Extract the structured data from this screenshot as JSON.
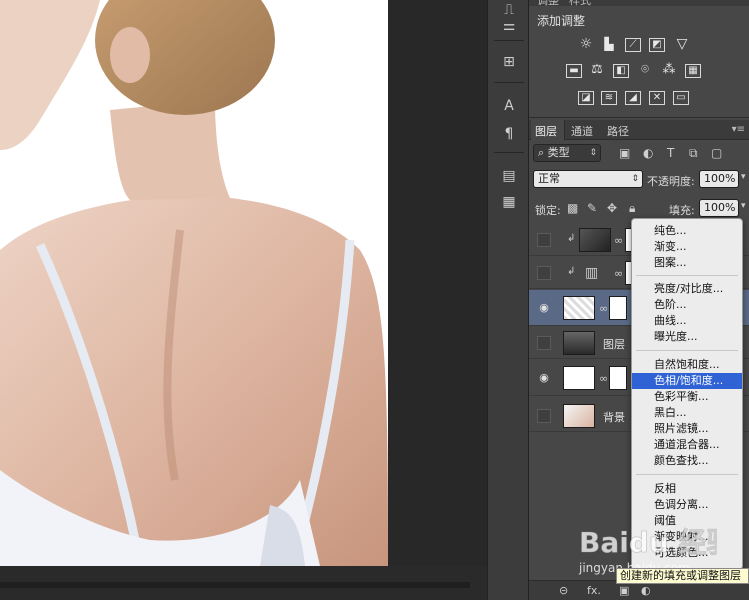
{
  "adjustments": {
    "tabs": [
      "调整",
      "样式"
    ],
    "title": "添加调整",
    "row1_icons": [
      "brightness-icon",
      "levels-icon",
      "curves-icon",
      "exposure-icon",
      "triangle-icon"
    ],
    "row2_icons": [
      "vibrance-icon",
      "balance-icon",
      "bw-icon",
      "camera-icon",
      "circles-icon",
      "grid-icon"
    ],
    "row3_icons": [
      "invert-icon",
      "posterize-icon",
      "threshold-icon",
      "selective-icon",
      "gradient-map-icon"
    ]
  },
  "layers": {
    "tabs": [
      "图层",
      "通道",
      "路径"
    ],
    "filter_kind": "类型",
    "blend_mode": "正常",
    "opacity_label": "不透明度:",
    "opacity_value": "100%",
    "lock_label": "锁定:",
    "fill_label": "填充:",
    "fill_value": "100%",
    "items": [
      {
        "name": "",
        "visible": false
      },
      {
        "name": "",
        "visible": false
      },
      {
        "name": "",
        "visible": true,
        "selected": true
      },
      {
        "name": "图层",
        "visible": false
      },
      {
        "name": "",
        "visible": true
      },
      {
        "name": "背景",
        "visible": false
      }
    ],
    "bottom_fx": "fx."
  },
  "menu": {
    "items": [
      "纯色...",
      "渐变...",
      "图案...",
      "亮度/对比度...",
      "色阶...",
      "曲线...",
      "曝光度...",
      "自然饱和度...",
      "色相/饱和度...",
      "色彩平衡...",
      "黑白...",
      "照片滤镜...",
      "通道混合器...",
      "颜色查找...",
      "反相",
      "色调分离...",
      "阈值",
      "渐变映射...",
      "可选颜色..."
    ],
    "highlighted": "色相/饱和度..."
  },
  "tooltip": "创建新的填充或调整图层",
  "watermark": {
    "brand": "Baidu 经验",
    "url": "jingyan.baidu.com"
  },
  "colors": {
    "highlight": "#2f62d4",
    "panel": "#474747",
    "tooltip_bg": "#fdfbd0"
  }
}
